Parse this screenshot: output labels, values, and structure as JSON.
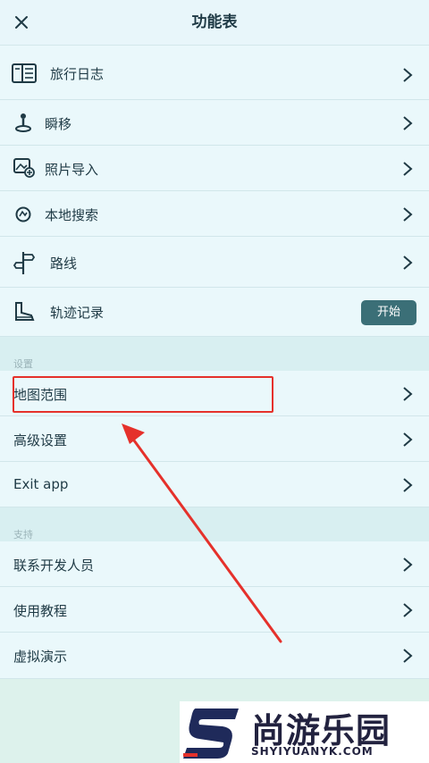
{
  "header": {
    "title": "功能表",
    "close_icon": "close-icon"
  },
  "menu": [
    {
      "label": "旅行日志",
      "icon": "travel-log-icon"
    },
    {
      "label": "瞬移",
      "icon": "teleport-icon"
    },
    {
      "label": "照片导入",
      "icon": "photo-import-icon"
    },
    {
      "label": "本地搜索",
      "icon": "local-search-icon"
    },
    {
      "label": "路线",
      "icon": "route-sign-icon"
    },
    {
      "label": "轨迹记录",
      "icon": "track-record-icon",
      "button": "开始"
    }
  ],
  "settings": {
    "title": "设置",
    "items": [
      {
        "label": "地图范围"
      },
      {
        "label": "高级设置"
      },
      {
        "label": "Exit app"
      }
    ]
  },
  "support": {
    "title": "支持",
    "items": [
      {
        "label": "联系开发人员"
      },
      {
        "label": "使用教程"
      },
      {
        "label": "虚拟演示"
      }
    ]
  },
  "annotation_color": "#e5312b",
  "accent_color": "#3b6f77",
  "watermark": {
    "cn": "尚游乐园",
    "en": "SHYIYUANYK.COM"
  }
}
